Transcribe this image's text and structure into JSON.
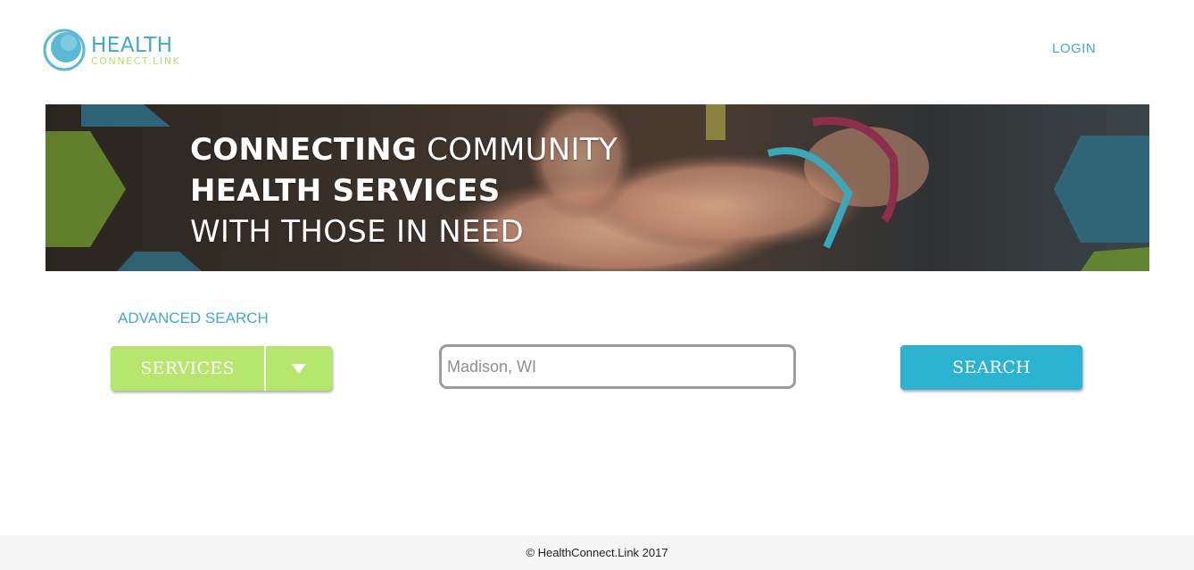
{
  "header": {
    "logo_word": "HEALTH",
    "logo_sub": "CONNECT.LINK",
    "login_label": "LOGIN"
  },
  "hero": {
    "line1_bold": "CONNECTING",
    "line1_rest": " COMMUNITY",
    "line2": "HEALTH SERVICES",
    "line3": "WITH THOSE IN NEED"
  },
  "search": {
    "advanced_label": "ADVANCED SEARCH",
    "services_label": "SERVICES",
    "location_placeholder": "Madison, WI",
    "location_value": "",
    "search_label": "SEARCH"
  },
  "footer": {
    "copyright": "© HealthConnect.Link 2017"
  },
  "colors": {
    "brand_blue": "#44a9c9",
    "brand_green": "#b6e66d",
    "search_button": "#2cb3d2"
  },
  "icons": [
    "logo-mark-icon",
    "chevron-down-icon"
  ]
}
